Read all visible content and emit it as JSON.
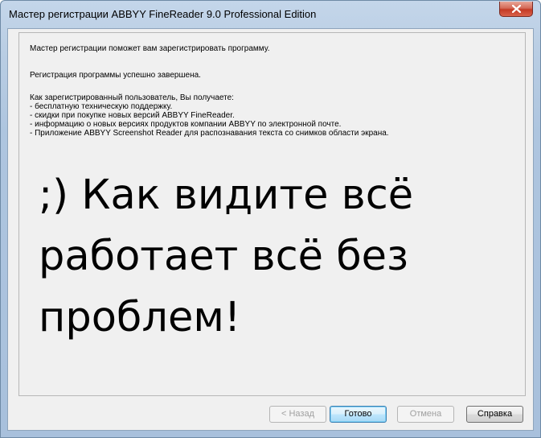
{
  "window": {
    "title": "Мастер регистрации ABBYY FineReader 9.0 Professional Edition"
  },
  "intro": "Мастер регистрации поможет вам зарегистрировать программу.",
  "status": "Регистрация программы успешно завершена.",
  "benefits": {
    "heading": "Как зарегистрированный пользователь, Вы получаете:",
    "items": [
      "- бесплатную техническую поддержку.",
      "- скидки при покупке новых версий ABBYY FineReader.",
      "- информацию о новых версиях продуктов компании ABBYY по электронной почте.",
      "- Приложение ABBYY Screenshot Reader для распознавания текста со снимков области экрана."
    ]
  },
  "overlay": {
    "lines": [
      ";) Как видите всё",
      "работает всё без",
      "проблем!"
    ]
  },
  "buttons": {
    "back": "< Назад",
    "finish": "Готово",
    "cancel": "Отмена",
    "help": "Справка"
  },
  "icons": {
    "close": "close-icon"
  }
}
